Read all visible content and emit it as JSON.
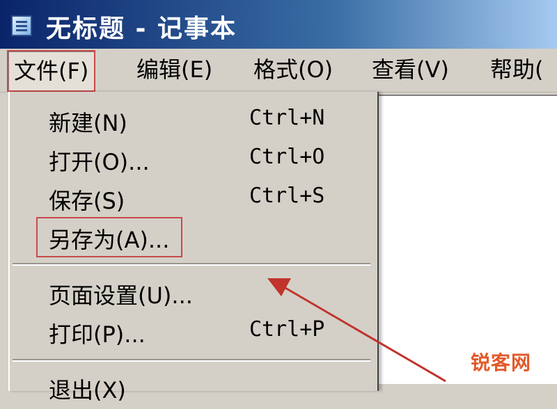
{
  "window": {
    "title": "无标题 - 记事本"
  },
  "menubar": {
    "file": "文件(F)",
    "edit": "编辑(E)",
    "format": "格式(O)",
    "view": "查看(V)",
    "help": "帮助("
  },
  "file_menu": {
    "items": [
      {
        "label": "新建(N)",
        "shortcut": "Ctrl+N"
      },
      {
        "label": "打开(O)...",
        "shortcut": "Ctrl+O"
      },
      {
        "label": "保存(S)",
        "shortcut": "Ctrl+S"
      },
      {
        "label": "另存为(A)...",
        "shortcut": ""
      },
      {
        "label": "页面设置(U)...",
        "shortcut": ""
      },
      {
        "label": "打印(P)...",
        "shortcut": "Ctrl+P"
      },
      {
        "label": "退出(X)",
        "shortcut": ""
      }
    ]
  },
  "watermark": {
    "text": "锐客网"
  },
  "colors": {
    "highlight_box": "#c74a4a",
    "arrow": "#c0342c"
  },
  "icons": {
    "title": "notepad-icon"
  }
}
